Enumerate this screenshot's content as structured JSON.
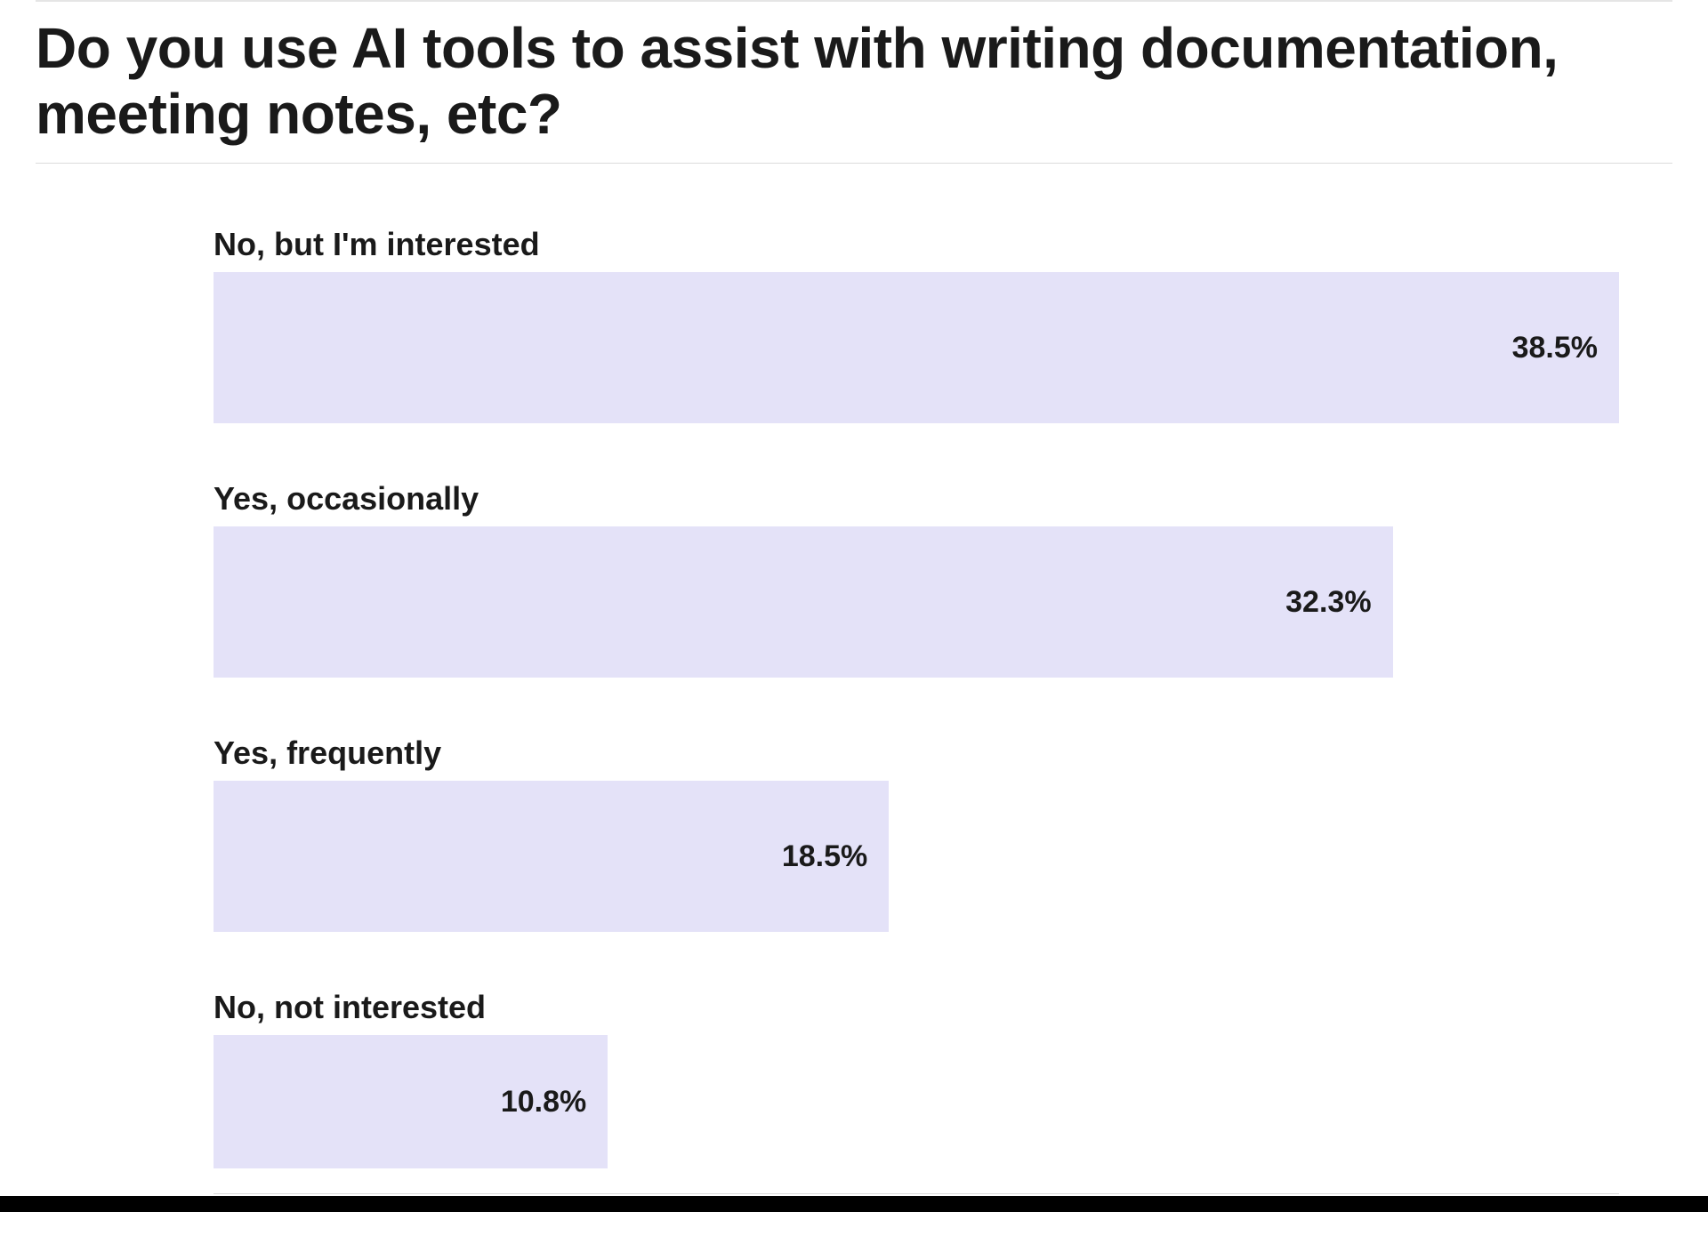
{
  "title": "Do you use AI tools to assist with writing documentation, meeting notes, etc?",
  "colors": {
    "bar_fill": "#e4e2f8",
    "text": "#1a1a1a"
  },
  "bars": [
    {
      "label": "No, but I'm interested",
      "value": 38.5,
      "display": "38.5%"
    },
    {
      "label": "Yes, occasionally",
      "value": 32.3,
      "display": "32.3%"
    },
    {
      "label": "Yes, frequently",
      "value": 18.5,
      "display": "18.5%"
    },
    {
      "label": "No, not interested",
      "value": 10.8,
      "display": "10.8%"
    }
  ],
  "chart_data": {
    "type": "bar",
    "orientation": "horizontal",
    "title": "Do you use AI tools to assist with writing documentation, meeting notes, etc?",
    "xlabel": "",
    "ylabel": "",
    "categories": [
      "No, but I'm interested",
      "Yes, occasionally",
      "Yes, frequently",
      "No, not interested"
    ],
    "values": [
      38.5,
      32.3,
      18.5,
      10.8
    ],
    "unit": "%",
    "xlim": [
      0,
      40
    ]
  }
}
